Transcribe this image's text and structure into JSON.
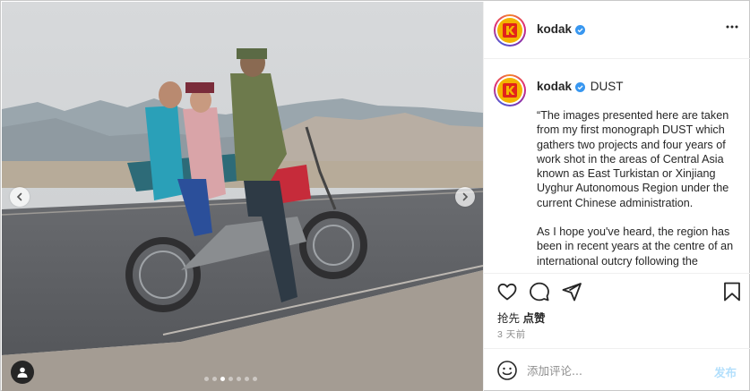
{
  "photo": {
    "description_icon": "photo-of-family-on-motorcycle",
    "carousel_dots": 7,
    "active_dot": 2
  },
  "post": {
    "username": "kodak",
    "verified": true,
    "caption_title": "DUST",
    "caption_paragraphs": [
      "“The images presented here are taken from my first monograph DUST which gathers two projects and four years of work shot in the areas of Central Asia known as East Turkistan or Xinjiang Uyghur Autonomous Region under the current Chinese administration.",
      "As I hope you've heard, the region has been in recent years at the centre of an international outcry following the"
    ],
    "likes_prefix": "抢先",
    "likes_action": "点赞",
    "timestamp": "3 天前"
  },
  "comment": {
    "placeholder": "添加评论...",
    "post_label": "发布"
  },
  "icons": {
    "verified": "verified-badge-icon",
    "more": "more-options-icon",
    "like": "heart-icon",
    "comment": "comment-icon",
    "share": "paper-plane-icon",
    "save": "bookmark-icon",
    "emoji": "emoji-icon",
    "user_tag": "user-icon",
    "prev": "chevron-left-icon",
    "next": "chevron-right-icon"
  },
  "colors": {
    "verified_blue": "#3897f0",
    "kodak_yellow": "#f4b400",
    "kodak_red": "#e2231a",
    "post_button_disabled": "#b2dffc"
  }
}
